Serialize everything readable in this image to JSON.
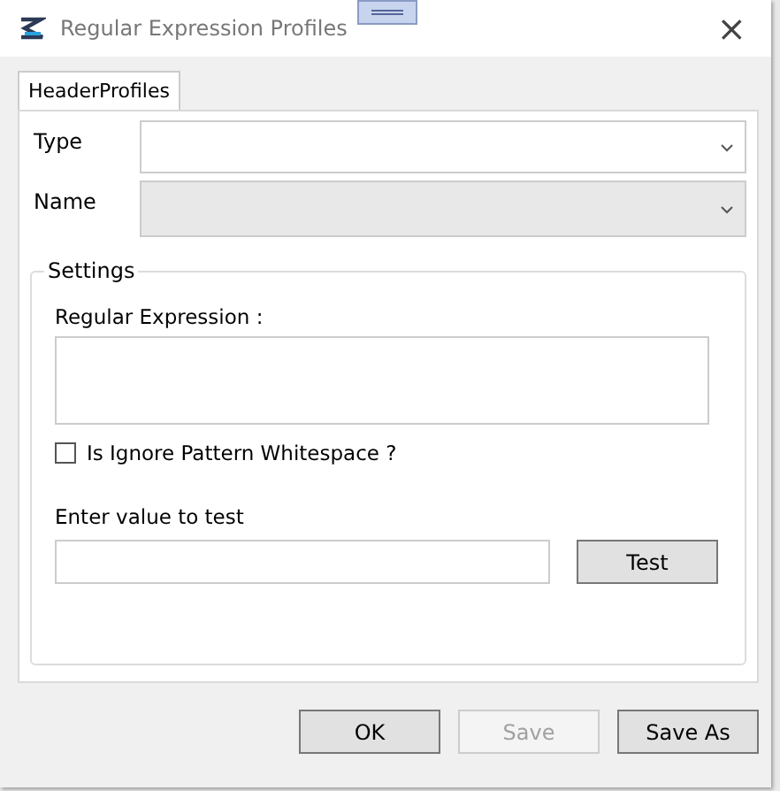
{
  "window": {
    "title": "Regular Expression Profiles",
    "close": "×"
  },
  "tabs": [
    {
      "label": "HeaderProfiles",
      "selected": true
    }
  ],
  "fields": [
    {
      "label": "Type",
      "disabled": false
    },
    {
      "label": "Name",
      "disabled": true
    }
  ],
  "settings": {
    "title": "Settings",
    "regex_label": "Regular Expression :",
    "ignore_whitespace": {
      "label": "Is Ignore Pattern Whitespace ?",
      "checked": false
    },
    "test_label": "Enter value to test",
    "test_button": "Test"
  },
  "buttons": [
    {
      "label": "OK",
      "disabled": false
    },
    {
      "label": "Save",
      "disabled": true
    },
    {
      "label": "Save As",
      "disabled": false
    }
  ]
}
